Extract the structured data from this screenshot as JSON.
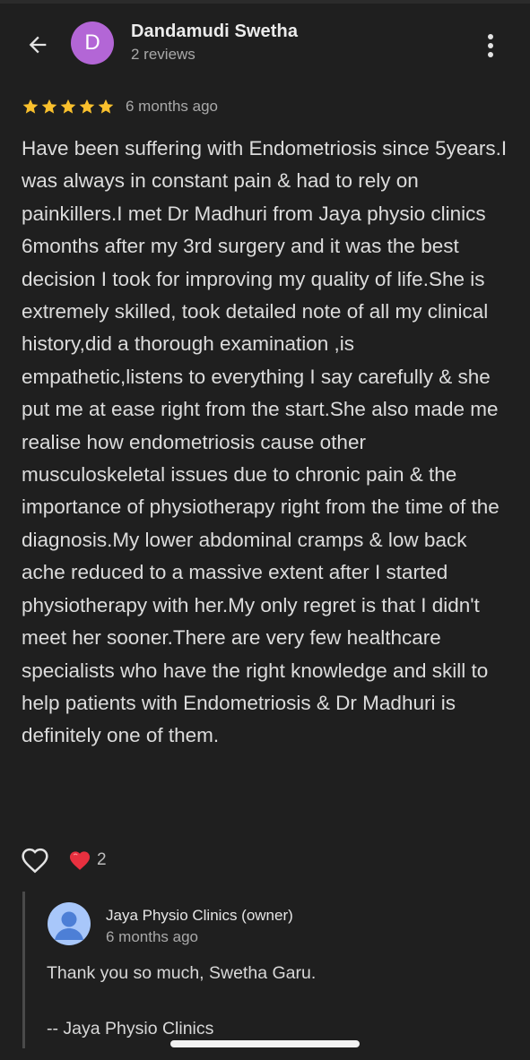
{
  "header": {
    "avatar_initial": "D",
    "avatar_color": "#b366d6",
    "reviewer_name": "Dandamudi Swetha",
    "reviewer_count": "2 reviews",
    "back_icon": "arrow-back-icon",
    "menu_icon": "more-vert-icon"
  },
  "review": {
    "stars": 5,
    "star_color": "#f9c02d",
    "time_ago": "6 months ago",
    "text": "Have been suffering with Endometriosis since 5years.I was always in constant pain & had to rely on painkillers.I met Dr Madhuri from Jaya physio clinics 6months after my 3rd surgery and it was the best decision I took for improving my quality of life.She is extremely skilled, took detailed note of all my clinical history,did a thorough examination ,is empathetic,listens to everything I say carefully & she put me at ease right from the start.She also made me realise how endometriosis cause other musculoskeletal issues due to chronic pain & the importance of physiotherapy right from the time of the diagnosis.My lower abdominal cramps & low back ache reduced to a massive extent after I started physiotherapy with her.My only regret is that I didn't meet her sooner.There are very few healthcare specialists who have the right knowledge and skill to help patients with Endometriosis & Dr Madhuri is definitely one of them."
  },
  "reactions": {
    "like_icon": "heart-outline-icon",
    "heart_icon": "red-heart-icon",
    "heart_count": "2"
  },
  "owner_reply": {
    "name": "Jaya Physio Clinics (owner)",
    "time_ago": "6 months ago",
    "text": "Thank you so much, Swetha Garu.\n\n-- Jaya Physio Clinics"
  }
}
